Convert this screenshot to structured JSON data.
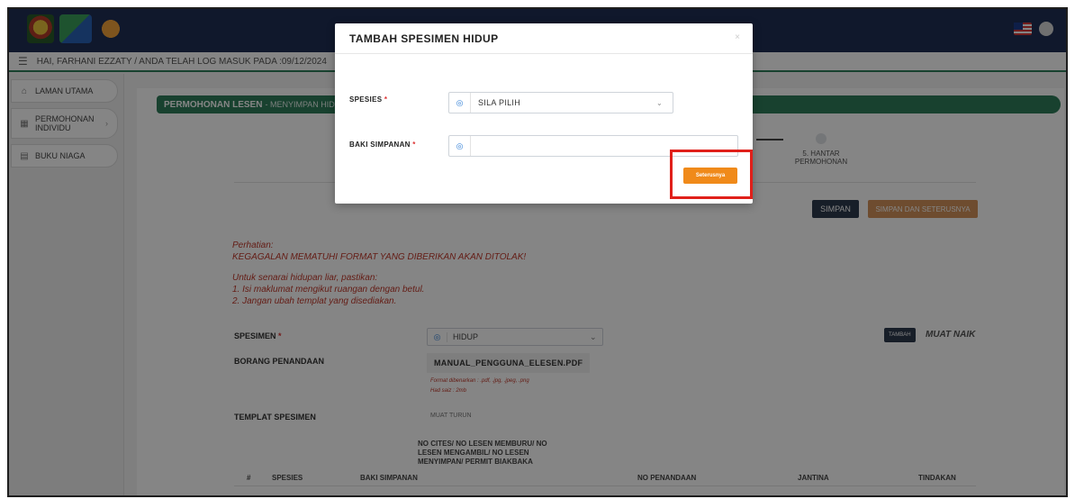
{
  "header": {
    "greeting": "HAI, FARHANI EZZATY / ANDA TELAH LOG MASUK PADA :09/12/2024"
  },
  "sidebar": {
    "items": [
      {
        "label": "LAMAN UTAMA",
        "icon": "home-icon"
      },
      {
        "label": "PERMOHONAN INDIVIDU",
        "icon": "grid-icon"
      },
      {
        "label": "BUKU NIAGA",
        "icon": "book-icon"
      }
    ]
  },
  "page": {
    "title": "PERMOHONAN LESEN",
    "subtitle": "- MENYIMPAN HIDUP",
    "step5_label": "5. HANTAR PERMOHONAN",
    "simpan_label": "SIMPAN",
    "simpan_seterusnya_label": "SIMPAN DAN SETERUSNYA",
    "notice": {
      "line1": "Perhatian:",
      "line2": "KEGAGALAN MEMATUHI FORMAT YANG DIBERIKAN AKAN DITOLAK!",
      "line3": "Untuk senarai hidupan liar, pastikan:",
      "line4": "1. Isi maklumat mengikut ruangan dengan betul.",
      "line5": "2. Jangan ubah templat yang disediakan."
    },
    "spesimen_label": "SPESIMEN",
    "spesimen_value": "HIDUP",
    "tambah_label": "TAMBAH",
    "muat_naik_label": "MUAT NAIK",
    "borang_label": "BORANG PENANDAAN",
    "borang_file": "MANUAL_PENGGUNA_ELESEN.PDF",
    "format_hint": "Format dibenarkan : .pdf, .jpg, .jpeg, .png",
    "size_hint": "Had saiz : 2mb",
    "templat_label": "TEMPLAT SPESIMEN",
    "muat_turun_label": "MUAT TURUN",
    "table_headers": {
      "no": "#",
      "spesies": "SPESIES",
      "baki": "BAKI SIMPANAN",
      "cites": "NO CITES/ NO LESEN MEMBURU/ NO LESEN MENGAMBIL/ NO LESEN MENYIMPAN/ PERMIT BIAKBAKA",
      "penandaan": "NO PENANDAAN",
      "jantina": "JANTINA",
      "tindakan": "TINDAKAN"
    }
  },
  "modal": {
    "title": "TAMBAH SPESIMEN HIDUP",
    "close": "×",
    "spesies_label": "SPESIES",
    "spesies_value": "SILA PILIH",
    "baki_label": "BAKI SIMPANAN",
    "baki_value": "",
    "seterusnya_label": "Seterusnya",
    "required_mark": "*"
  },
  "colors": {
    "topbar": "#1f2f55",
    "accent_green": "#2e7d5a",
    "seterusnya": "#f08a1a",
    "highlight": "#e0201a"
  }
}
